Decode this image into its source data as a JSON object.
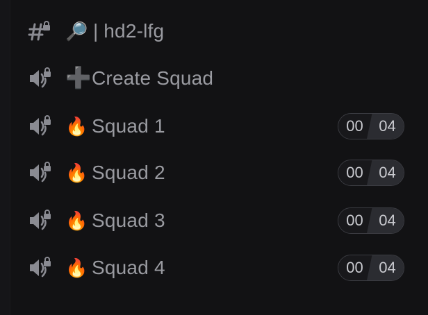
{
  "category_channel": {
    "icon": "text-channel-locked-icon",
    "emoji": "🔎",
    "separator": "|",
    "name": "hd2-lfg"
  },
  "create_squad": {
    "icon": "voice-channel-locked-icon",
    "emoji": "➕",
    "name": "Create Squad"
  },
  "squads": [
    {
      "icon": "voice-channel-locked-icon",
      "emoji": "🔥",
      "name": "Squad 1",
      "current": "00",
      "limit": "04"
    },
    {
      "icon": "voice-channel-locked-icon",
      "emoji": "🔥",
      "name": "Squad 2",
      "current": "00",
      "limit": "04"
    },
    {
      "icon": "voice-channel-locked-icon",
      "emoji": "🔥",
      "name": "Squad 3",
      "current": "00",
      "limit": "04"
    },
    {
      "icon": "voice-channel-locked-icon",
      "emoji": "🔥",
      "name": "Squad 4",
      "current": "00",
      "limit": "04"
    }
  ],
  "colors": {
    "background": "#121214",
    "text": "#9a9ba1",
    "counter_border": "#3b3c42",
    "counter_right_bg": "#2b2c31"
  }
}
